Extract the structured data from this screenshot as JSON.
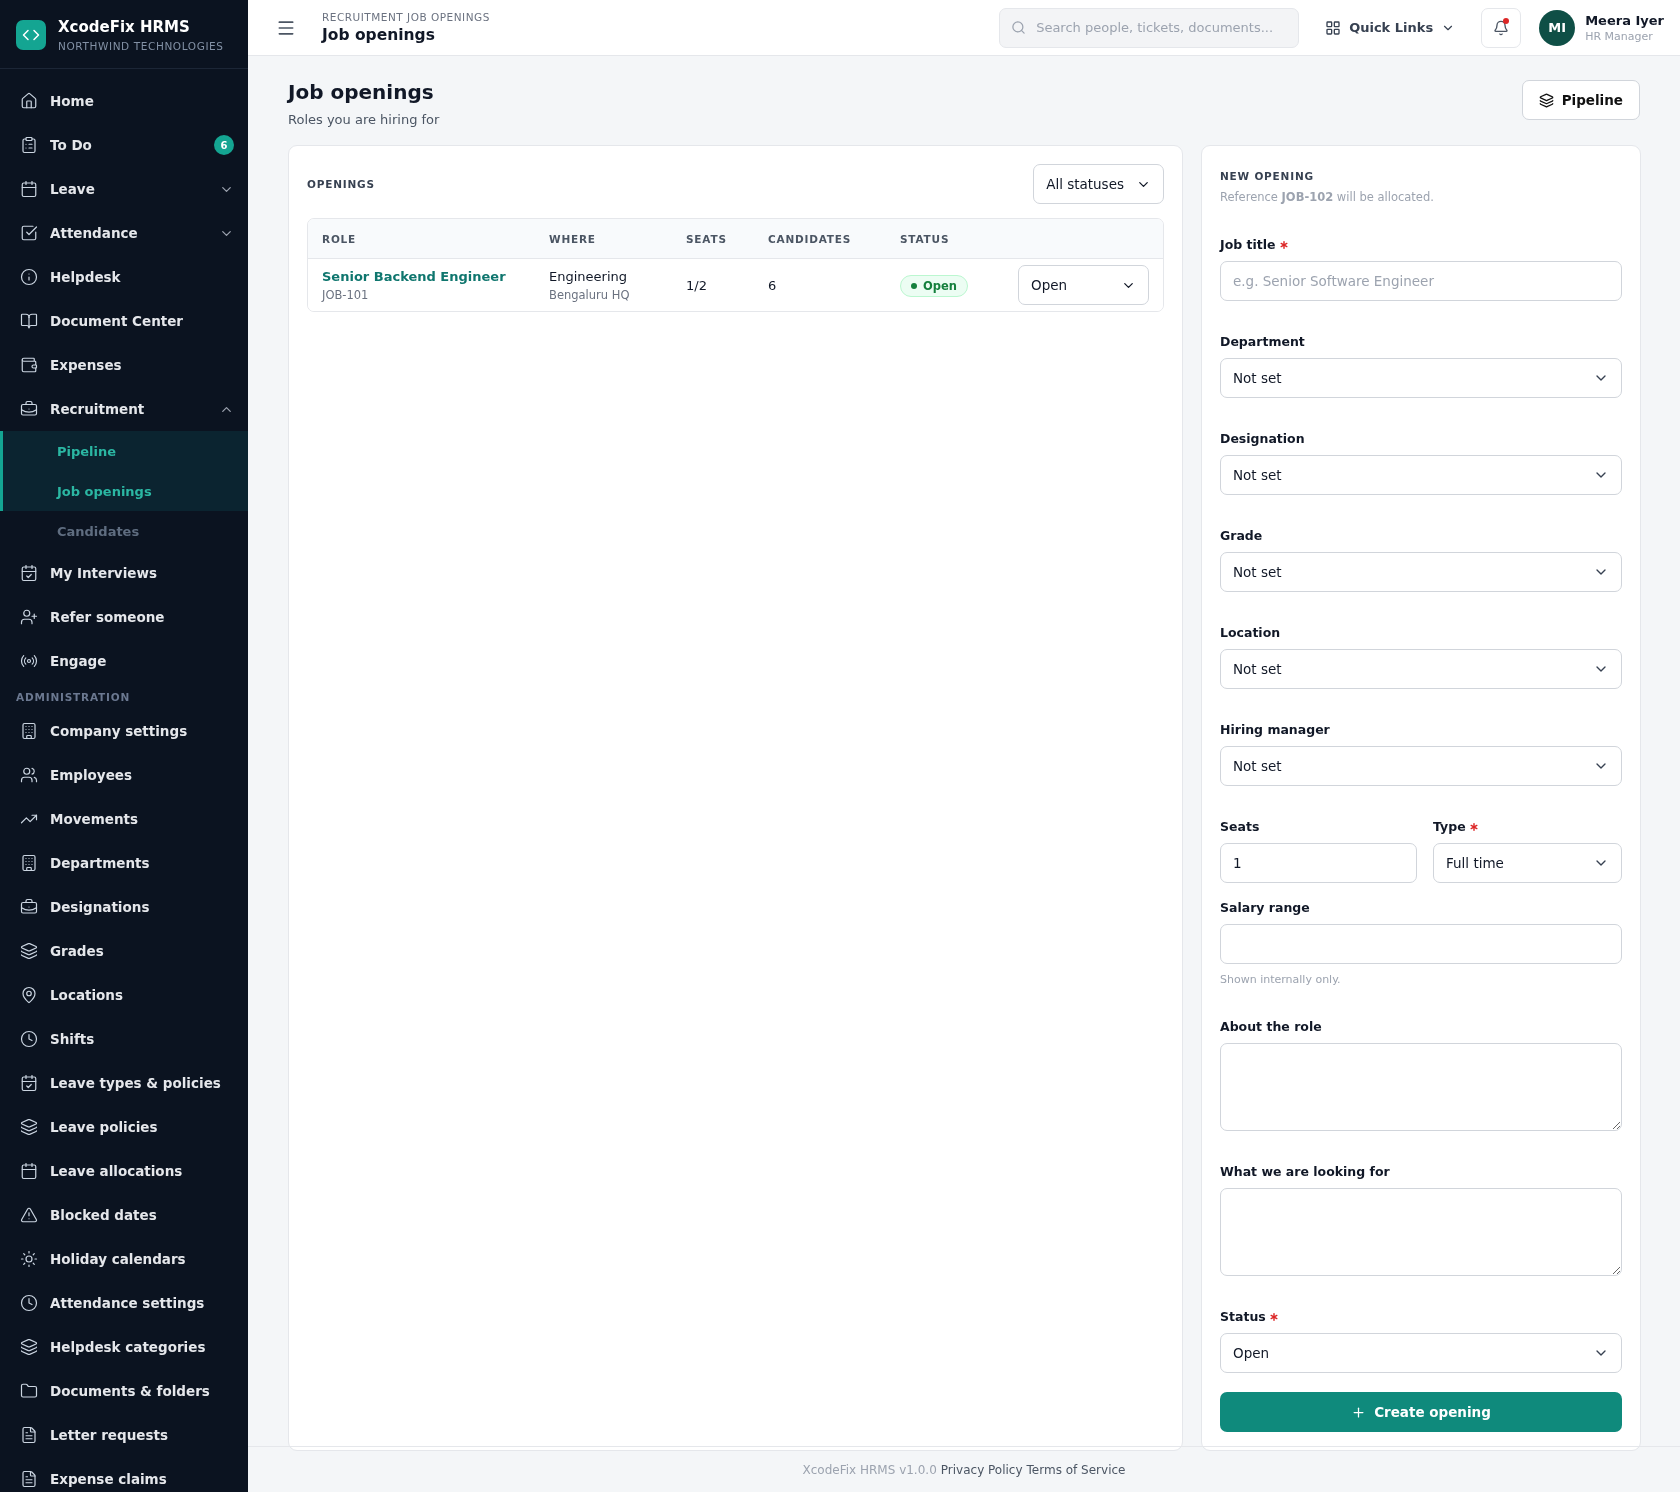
{
  "brand": {
    "name": "XcodeFix HRMS",
    "org": "NORTHWIND TECHNOLOGIES"
  },
  "nav": [
    {
      "label": "Home"
    },
    {
      "label": "To Do",
      "badge": "6"
    },
    {
      "label": "Leave",
      "expanded": false
    },
    {
      "label": "Attendance",
      "expanded": false
    },
    {
      "label": "Helpdesk"
    },
    {
      "label": "Document Center"
    },
    {
      "label": "Expenses"
    },
    {
      "label": "Recruitment",
      "expanded": true,
      "children": [
        {
          "label": "Pipeline",
          "selected": true
        },
        {
          "label": "Job openings",
          "selected": true
        },
        {
          "label": "Candidates",
          "selected": false
        }
      ]
    },
    {
      "label": "My Interviews"
    },
    {
      "label": "Refer someone"
    },
    {
      "label": "Engage"
    }
  ],
  "admin": {
    "title": "ADMINISTRATION",
    "items": [
      {
        "label": "Company settings"
      },
      {
        "label": "Employees"
      },
      {
        "label": "Movements"
      },
      {
        "label": "Departments"
      },
      {
        "label": "Designations"
      },
      {
        "label": "Grades"
      },
      {
        "label": "Locations"
      },
      {
        "label": "Shifts"
      },
      {
        "label": "Leave types & policies"
      },
      {
        "label": "Leave policies"
      },
      {
        "label": "Leave allocations"
      },
      {
        "label": "Blocked dates"
      },
      {
        "label": "Holiday calendars"
      },
      {
        "label": "Attendance settings"
      },
      {
        "label": "Helpdesk categories"
      },
      {
        "label": "Documents & folders"
      },
      {
        "label": "Letter requests"
      },
      {
        "label": "Expense claims"
      }
    ]
  },
  "header": {
    "breadcrumb": "RECRUITMENT JOB OPENINGS",
    "title": "Job openings",
    "search": {
      "placeholder": "Search people, tickets, documents..."
    },
    "quick_links": "Quick Links",
    "notifications_unread": true,
    "user": {
      "initials": "MI",
      "name": "Meera Iyer",
      "role": "HR Manager"
    }
  },
  "page": {
    "title": "Job openings",
    "subtitle": "Roles you are hiring for",
    "pipeline_button": "Pipeline"
  },
  "openings": {
    "title": "OPENINGS",
    "filter": "All statuses",
    "columns": [
      "ROLE",
      "WHERE",
      "SEATS",
      "CANDIDATES",
      "STATUS"
    ],
    "rows": [
      {
        "role": "Senior Backend Engineer",
        "code": "JOB-101",
        "department": "Engineering",
        "location": "Bengaluru HQ",
        "seats": "1/2",
        "candidates": "6",
        "status": "Open",
        "action": "Open"
      }
    ]
  },
  "new_opening": {
    "title": "NEW OPENING",
    "reference": "Reference **JOB-102** will be allocated.",
    "fields": [
      {
        "kind": "text",
        "label": "Job title",
        "required": true,
        "placeholder": "e.g. Senior Software Engineer"
      },
      {
        "kind": "select",
        "label": "Department",
        "required": false,
        "value": "Not set"
      },
      {
        "kind": "select",
        "label": "Designation",
        "required": false,
        "value": "Not set"
      },
      {
        "kind": "select",
        "label": "Grade",
        "required": false,
        "value": "Not set"
      },
      {
        "kind": "select",
        "label": "Location",
        "required": false,
        "value": "Not set"
      },
      {
        "kind": "select",
        "label": "Hiring manager",
        "required": false,
        "value": "Not set"
      },
      {
        "kind": "pair",
        "fields": [
          {
            "kind": "text",
            "label": "Seats",
            "required": false,
            "value": "1"
          },
          {
            "kind": "select",
            "label": "Type",
            "required": true,
            "value": "Full time"
          }
        ]
      },
      {
        "kind": "text",
        "label": "Salary range",
        "required": false,
        "hint": "Shown internally only."
      },
      {
        "kind": "textarea",
        "label": "About the role",
        "required": false
      },
      {
        "kind": "textarea",
        "label": "What we are looking for",
        "required": false
      },
      {
        "kind": "select",
        "label": "Status",
        "required": true,
        "value": "Open"
      }
    ],
    "submit": "Create opening"
  },
  "footer": {
    "version": "XcodeFix HRMS v1.0.0",
    "links": [
      "Privacy Policy",
      "Terms of Service"
    ]
  }
}
